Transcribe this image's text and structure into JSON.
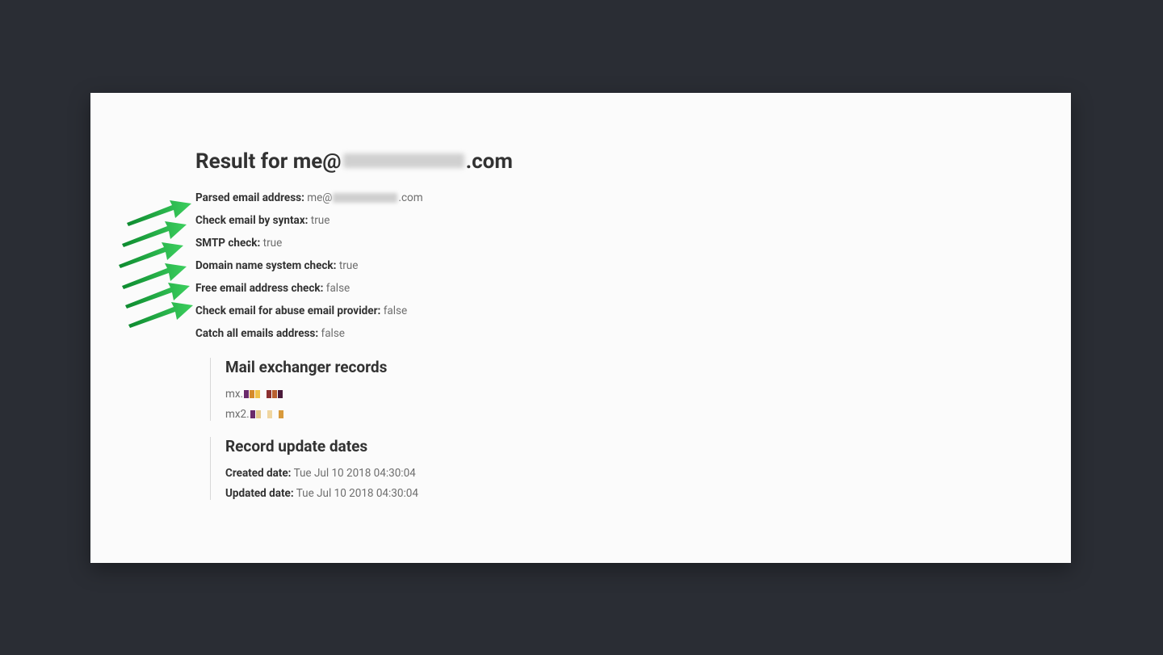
{
  "title_prefix": "Result for me@",
  "title_suffix": ".com",
  "parsed_prefix": "me@",
  "parsed_suffix": ".com",
  "labels": {
    "parsed": "Parsed email address:",
    "syntax": "Check email by syntax:",
    "smtp": "SMTP check:",
    "dns": "Domain name system check:",
    "free": "Free email address check:",
    "abuse": "Check email for abuse email provider:",
    "catchall": "Catch all emails address:"
  },
  "values": {
    "syntax": "true",
    "smtp": "true",
    "dns": "true",
    "free": "false",
    "abuse": "false",
    "catchall": "false"
  },
  "mx_heading": "Mail exchanger records",
  "mx_records": {
    "r0_prefix": "mx.",
    "r1_prefix": "mx2."
  },
  "dates_heading": "Record update dates",
  "dates": {
    "created_label": "Created date:",
    "created_value": "Tue Jul 10 2018 04:30:04",
    "updated_label": "Updated date:",
    "updated_value": "Tue Jul 10 2018 04:30:04"
  }
}
